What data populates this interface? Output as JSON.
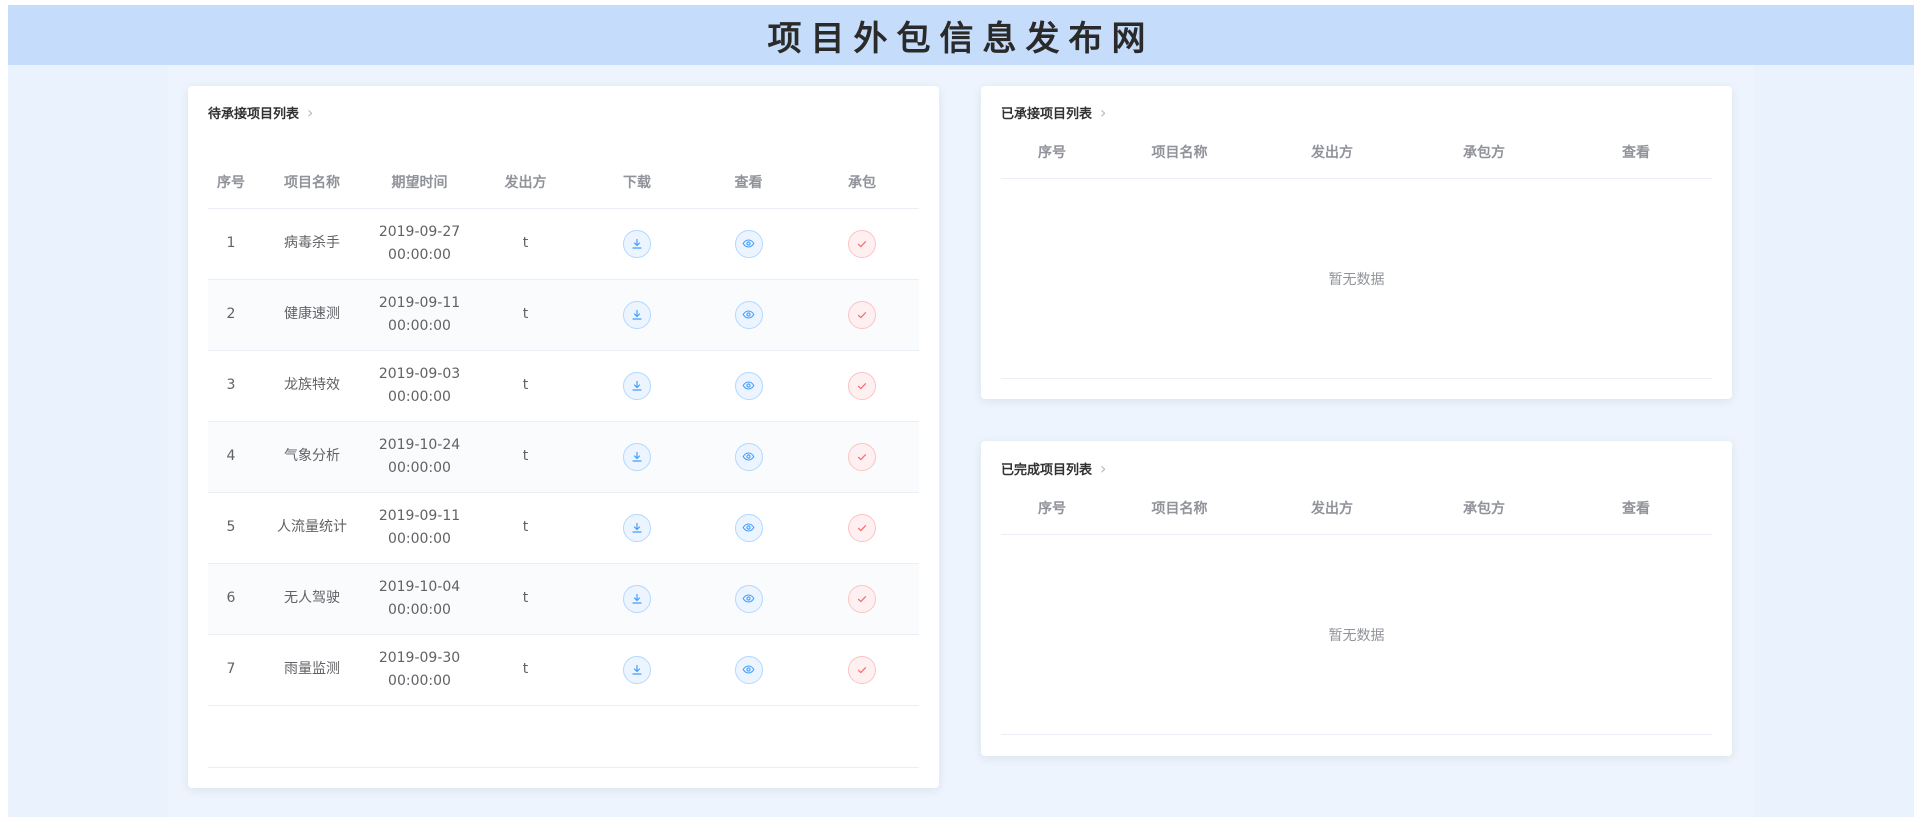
{
  "header": {
    "title": "项目外包信息发布网"
  },
  "pending": {
    "title": "待承接项目列表",
    "columns": [
      "序号",
      "项目名称",
      "期望时间",
      "发出方",
      "下载",
      "查看",
      "承包"
    ],
    "rows": [
      {
        "index": "1",
        "name": "病毒杀手",
        "date": "2019-09-27",
        "time": "00:00:00",
        "sender": "t"
      },
      {
        "index": "2",
        "name": "健康速测",
        "date": "2019-09-11",
        "time": "00:00:00",
        "sender": "t"
      },
      {
        "index": "3",
        "name": "龙族特效",
        "date": "2019-09-03",
        "time": "00:00:00",
        "sender": "t"
      },
      {
        "index": "4",
        "name": "气象分析",
        "date": "2019-10-24",
        "time": "00:00:00",
        "sender": "t"
      },
      {
        "index": "5",
        "name": "人流量统计",
        "date": "2019-09-11",
        "time": "00:00:00",
        "sender": "t"
      },
      {
        "index": "6",
        "name": "无人驾驶",
        "date": "2019-10-04",
        "time": "00:00:00",
        "sender": "t"
      },
      {
        "index": "7",
        "name": "雨量监测",
        "date": "2019-09-30",
        "time": "00:00:00",
        "sender": "t"
      }
    ],
    "icons": {
      "download": "download-icon",
      "view": "eye-icon",
      "contract": "check-icon"
    },
    "colors": {
      "info": "#409eff",
      "danger": "#f56c6c"
    }
  },
  "accepted": {
    "title": "已承接项目列表",
    "columns": [
      "序号",
      "项目名称",
      "发出方",
      "承包方",
      "查看"
    ],
    "empty_text": "暂无数据"
  },
  "completed": {
    "title": "已完成项目列表",
    "columns": [
      "序号",
      "项目名称",
      "发出方",
      "承包方",
      "查看"
    ],
    "empty_text": "暂无数据"
  }
}
